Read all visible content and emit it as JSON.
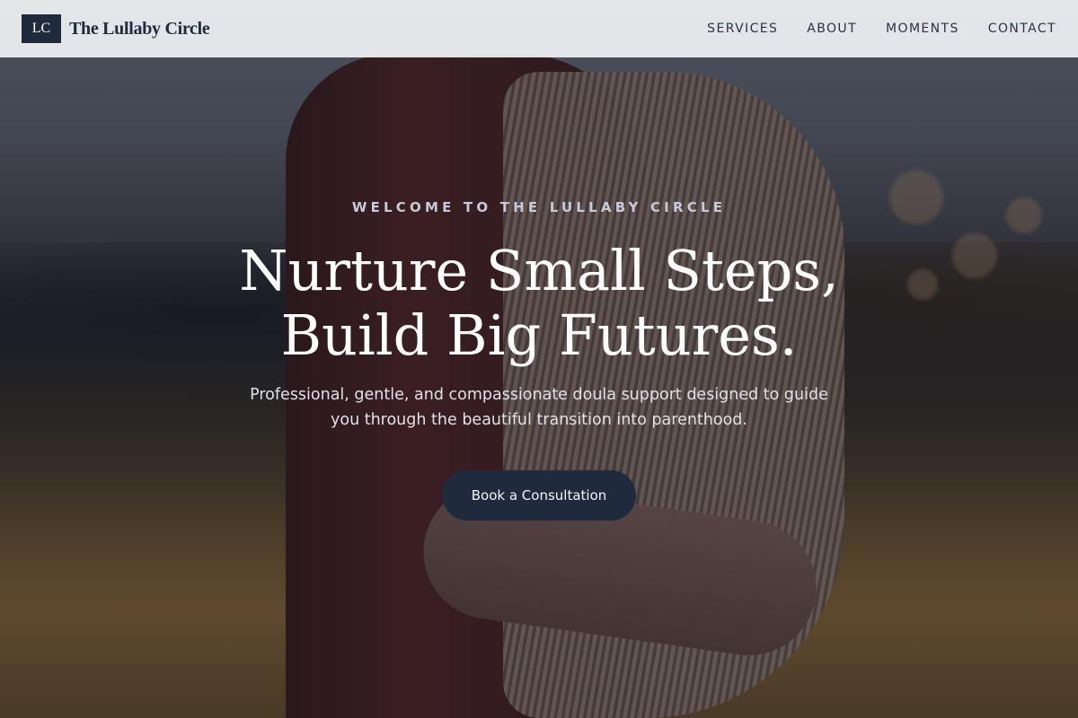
{
  "header": {
    "logo_initials": "LC",
    "brand_name": "The Lullaby Circle",
    "nav": [
      {
        "label": "SERVICES"
      },
      {
        "label": "ABOUT"
      },
      {
        "label": "MOMENTS"
      },
      {
        "label": "CONTACT"
      }
    ]
  },
  "hero": {
    "eyebrow": "WELCOME TO THE LULLABY CIRCLE",
    "headline_line1": "Nurture Small Steps,",
    "headline_line2": "Build Big Futures.",
    "subtext": "Professional, gentle, and compassionate doula support designed to guide you through the beautiful transition into parenthood.",
    "cta_label": "Book a Consultation"
  },
  "colors": {
    "brand_navy": "#1f2a3d",
    "header_bg": "#f0f1f3",
    "eyebrow_text": "#c6cbd8"
  }
}
